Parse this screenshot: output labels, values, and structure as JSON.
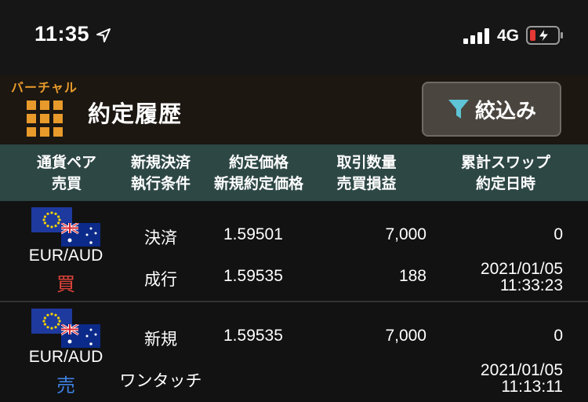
{
  "status_bar": {
    "time": "11:35",
    "network": "4G"
  },
  "header": {
    "mode_tag": "バーチャル",
    "title": "約定履歴",
    "filter_label": "絞込み"
  },
  "columns": {
    "c1_line1": "通貨ペア",
    "c1_line2": "売買",
    "c2_line1": "新規決済",
    "c2_line2": "執行条件",
    "c3_line1": "約定価格",
    "c3_line2": "新規約定価格",
    "c4_line1": "取引数量",
    "c4_line2": "売買損益",
    "c5_line1": "累計スワップ",
    "c5_line2": "約定日時"
  },
  "trades": [
    {
      "pair": "EUR/AUD",
      "side": "買",
      "settle_type": "決済",
      "condition": "成行",
      "price": "1.59501",
      "open_price": "1.59535",
      "quantity": "7,000",
      "pl": "188",
      "swap": "0",
      "date": "2021/01/05",
      "time": "11:33:23"
    },
    {
      "pair": "EUR/AUD",
      "side": "売",
      "settle_type": "新規",
      "condition": "ワンタッチ",
      "price": "1.59535",
      "open_price": "",
      "quantity": "7,000",
      "pl": "",
      "swap": "0",
      "date": "2021/01/05",
      "time": "11:13:11"
    }
  ],
  "colors": {
    "accent": "#e89a2b",
    "buy": "#e0443a",
    "sell": "#3d7fe0",
    "header_band": "#2d4745"
  },
  "icons": {
    "location": "location-arrow-icon",
    "signal": "cellular-signal-icon",
    "battery": "battery-charging-icon",
    "menu": "grid-menu-icon",
    "filter": "filter-funnel-icon",
    "flag_eu": "eu-flag-icon",
    "flag_au": "australia-flag-icon"
  }
}
